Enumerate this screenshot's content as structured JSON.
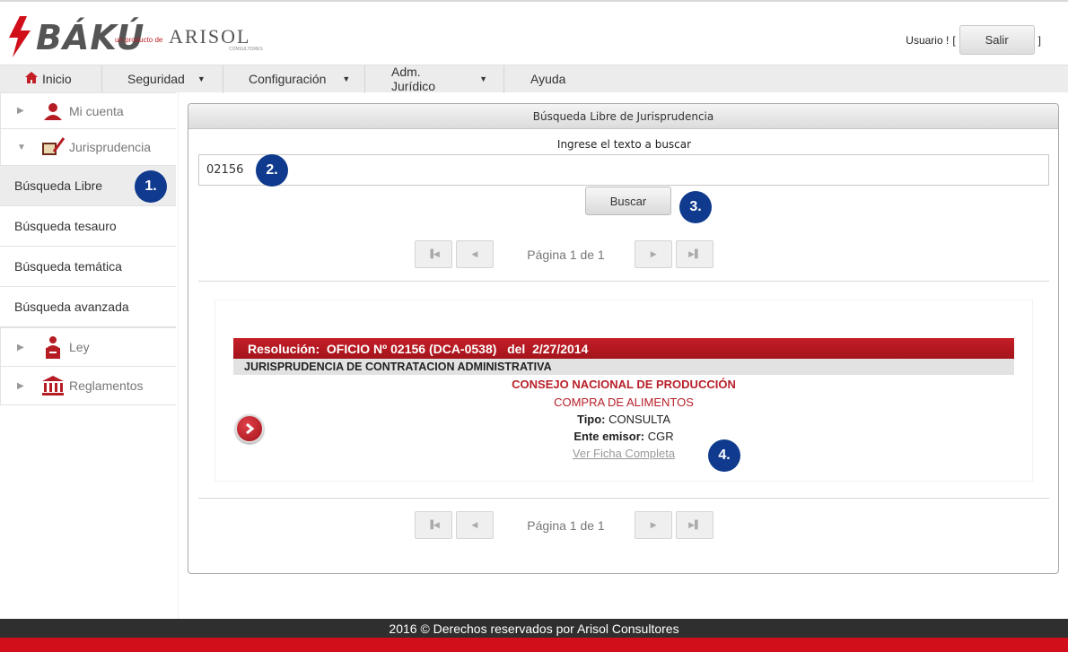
{
  "brand": {
    "name": "BÁKÚ",
    "producto_label": "un producto de",
    "company": "ARISOL",
    "company_sub": "CONSULTORES",
    "accent_color": "#d10f1b"
  },
  "user": {
    "label": "Usuario !",
    "open_bracket": "[",
    "close_bracket": "]",
    "logout_label": "Salir"
  },
  "menu": {
    "items": [
      {
        "label": "Inicio",
        "icon": "home-icon"
      },
      {
        "label": "Seguridad",
        "icon": "caret-down-icon"
      },
      {
        "label": "Configuración",
        "icon": "caret-down-icon"
      },
      {
        "label": "Adm. Jurídico",
        "icon": "caret-down-icon"
      },
      {
        "label": "Ayuda"
      }
    ]
  },
  "sidebar": {
    "groups": [
      {
        "label": "Mi cuenta",
        "icon": "user-icon",
        "expanded": false
      },
      {
        "label": "Jurisprudencia",
        "icon": "book-pen-icon",
        "expanded": true
      },
      {
        "label": "Ley",
        "icon": "speaker-podium-icon",
        "expanded": false
      },
      {
        "label": "Reglamentos",
        "icon": "institution-icon",
        "expanded": false
      }
    ],
    "subitems": [
      {
        "label": "Búsqueda Libre",
        "active": true
      },
      {
        "label": "Búsqueda tesauro"
      },
      {
        "label": "Búsqueda temática"
      },
      {
        "label": "Búsqueda avanzada"
      }
    ]
  },
  "panel": {
    "title": "Búsqueda Libre de Jurisprudencia",
    "search_label": "Ingrese el texto a buscar",
    "search_value": "02156",
    "search_button": "Buscar",
    "pager_text": "Página 1 de 1"
  },
  "result": {
    "header": "Resolución:  OFICIO Nº 02156 (DCA-0538)   del  2/27/2014",
    "category": "JURISPRUDENCIA DE CONTRATACION ADMINISTRATIVA",
    "institution": "CONSEJO NACIONAL DE PRODUCCIÓN",
    "subject": "COMPRA DE ALIMENTOS",
    "tipo_label": "Tipo:",
    "tipo_value": "CONSULTA",
    "ente_label": "Ente emisor:",
    "ente_value": "CGR",
    "link_label": "Ver Ficha Completa"
  },
  "annotations": {
    "step1": "1.",
    "step2": "2.",
    "step3": "3.",
    "step4": "4.",
    "badge_color": "#0f3a8e"
  },
  "footer": {
    "text": "2016 © Derechos reservados por Arisol Consultores"
  }
}
